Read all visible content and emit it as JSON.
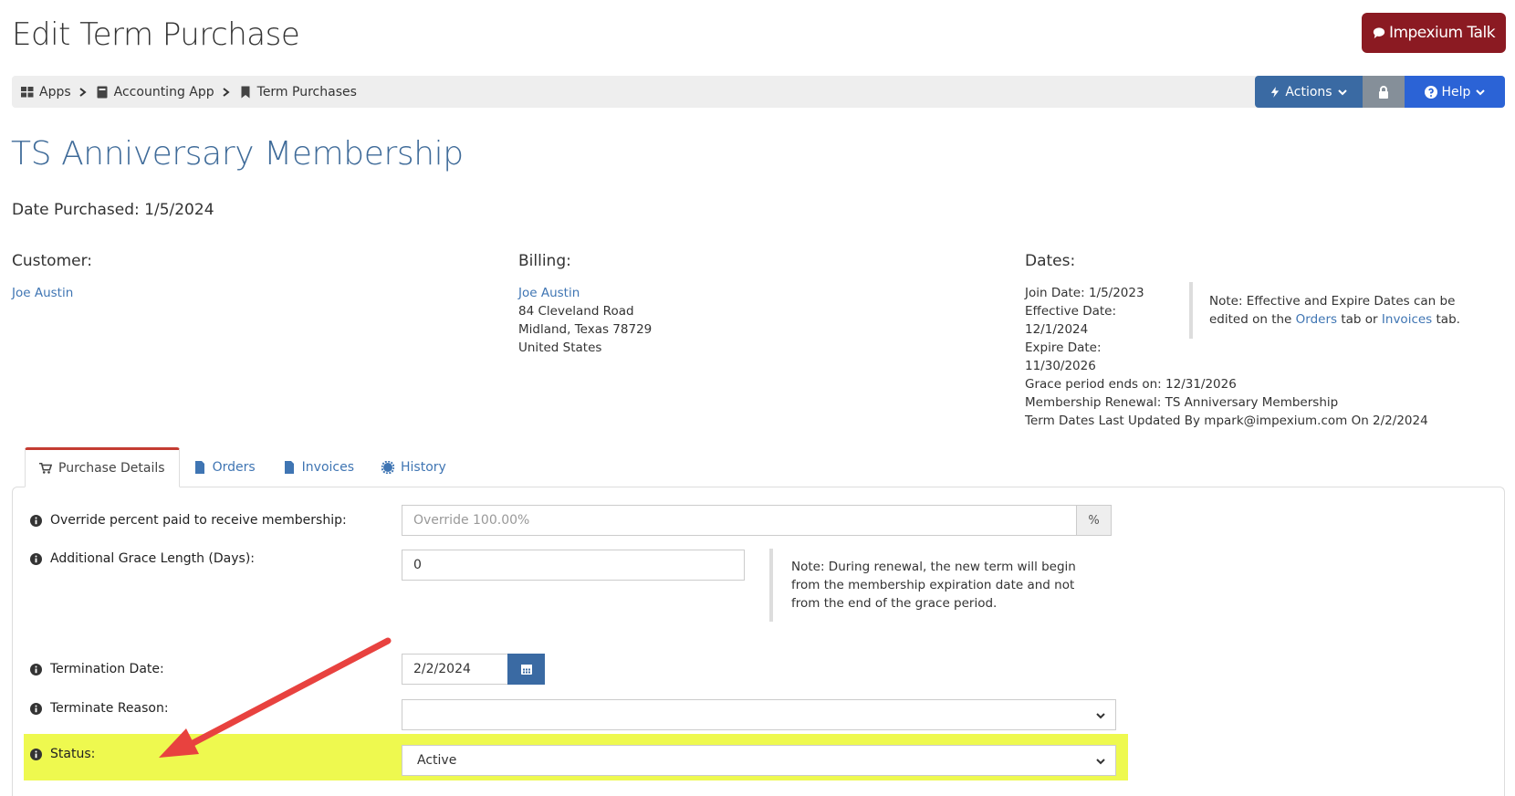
{
  "header": {
    "title": "Edit Term Purchase",
    "talk_button": "Impexium Talk"
  },
  "breadcrumb": {
    "items": [
      "Apps",
      "Accounting App",
      "Term Purchases"
    ]
  },
  "toolbar": {
    "actions_label": "Actions",
    "help_label": "Help"
  },
  "record": {
    "title": "TS Anniversary Membership",
    "date_purchased": "Date Purchased: 1/5/2024"
  },
  "customer": {
    "heading": "Customer:",
    "name": "Joe Austin"
  },
  "billing": {
    "heading": "Billing:",
    "name": "Joe Austin",
    "address1": "84 Cleveland Road",
    "address2": "Midland, Texas 78729",
    "country": "United States"
  },
  "dates": {
    "heading": "Dates:",
    "join": "Join Date: 1/5/2023",
    "effective_label": "Effective Date:",
    "effective_value": "12/1/2024",
    "expire_label": "Expire Date:",
    "expire_value": "11/30/2026",
    "grace": "Grace period ends on: 12/31/2026",
    "renewal": "Membership Renewal: TS Anniversary Membership",
    "updated": "Term Dates Last Updated By mpark@impexium.com On 2/2/2024",
    "note_prefix": "Note: Effective and Expire Dates can be edited on the",
    "note_orders": "Orders",
    "note_mid": "tab or",
    "note_invoices": "Invoices",
    "note_suffix": "tab."
  },
  "tabs": [
    {
      "label": "Purchase Details"
    },
    {
      "label": "Orders"
    },
    {
      "label": "Invoices"
    },
    {
      "label": "History"
    }
  ],
  "form": {
    "override_label": "Override percent paid to receive membership:",
    "override_placeholder": "Override 100.00%",
    "override_addon": "%",
    "grace_label": "Additional Grace Length (Days):",
    "grace_value": "0",
    "renew_note": "Note: During renewal, the new term will begin from the membership expiration date and not from the end of the grace period.",
    "termination_label": "Termination Date:",
    "termination_value": "2/2/2024",
    "reason_label": "Terminate Reason:",
    "reason_value": "",
    "status_label": "Status:",
    "status_value": "Active"
  },
  "colors": {
    "accent": "#3a6aa3",
    "talk": "#8b1a22",
    "help": "#2b63d6",
    "highlight": "#eef94f",
    "arrow": "#e8423f"
  }
}
